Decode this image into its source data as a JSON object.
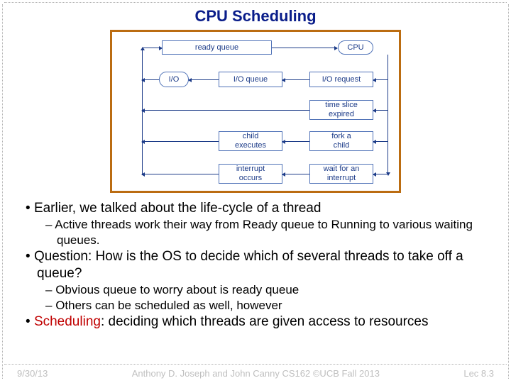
{
  "title": "CPU Scheduling",
  "diagram": {
    "ready_queue": "ready queue",
    "cpu": "CPU",
    "io": "I/O",
    "io_queue": "I/O queue",
    "io_request": "I/O request",
    "time_slice": "time slice\nexpired",
    "child_executes": "child\nexecutes",
    "fork_child": "fork a\nchild",
    "interrupt_occurs": "interrupt\noccurs",
    "wait_interrupt": "wait for an\ninterrupt"
  },
  "bullets": {
    "b1": "Earlier, we talked about the life-cycle of a thread",
    "b1a": "Active threads work their way from Ready queue to Running to various waiting queues.",
    "b2": "Question: How is the OS to decide which of several threads to take off a queue?",
    "b2a": "Obvious queue to worry about is ready queue",
    "b2b": "Others can be scheduled as well, however",
    "b3_prefix": "Scheduling",
    "b3_rest": ": deciding which threads are given access to resources"
  },
  "footer": {
    "date": "9/30/13",
    "center": "Anthony D. Joseph and John Canny    CS162    ©UCB Fall 2013",
    "right": "Lec 8.3"
  }
}
